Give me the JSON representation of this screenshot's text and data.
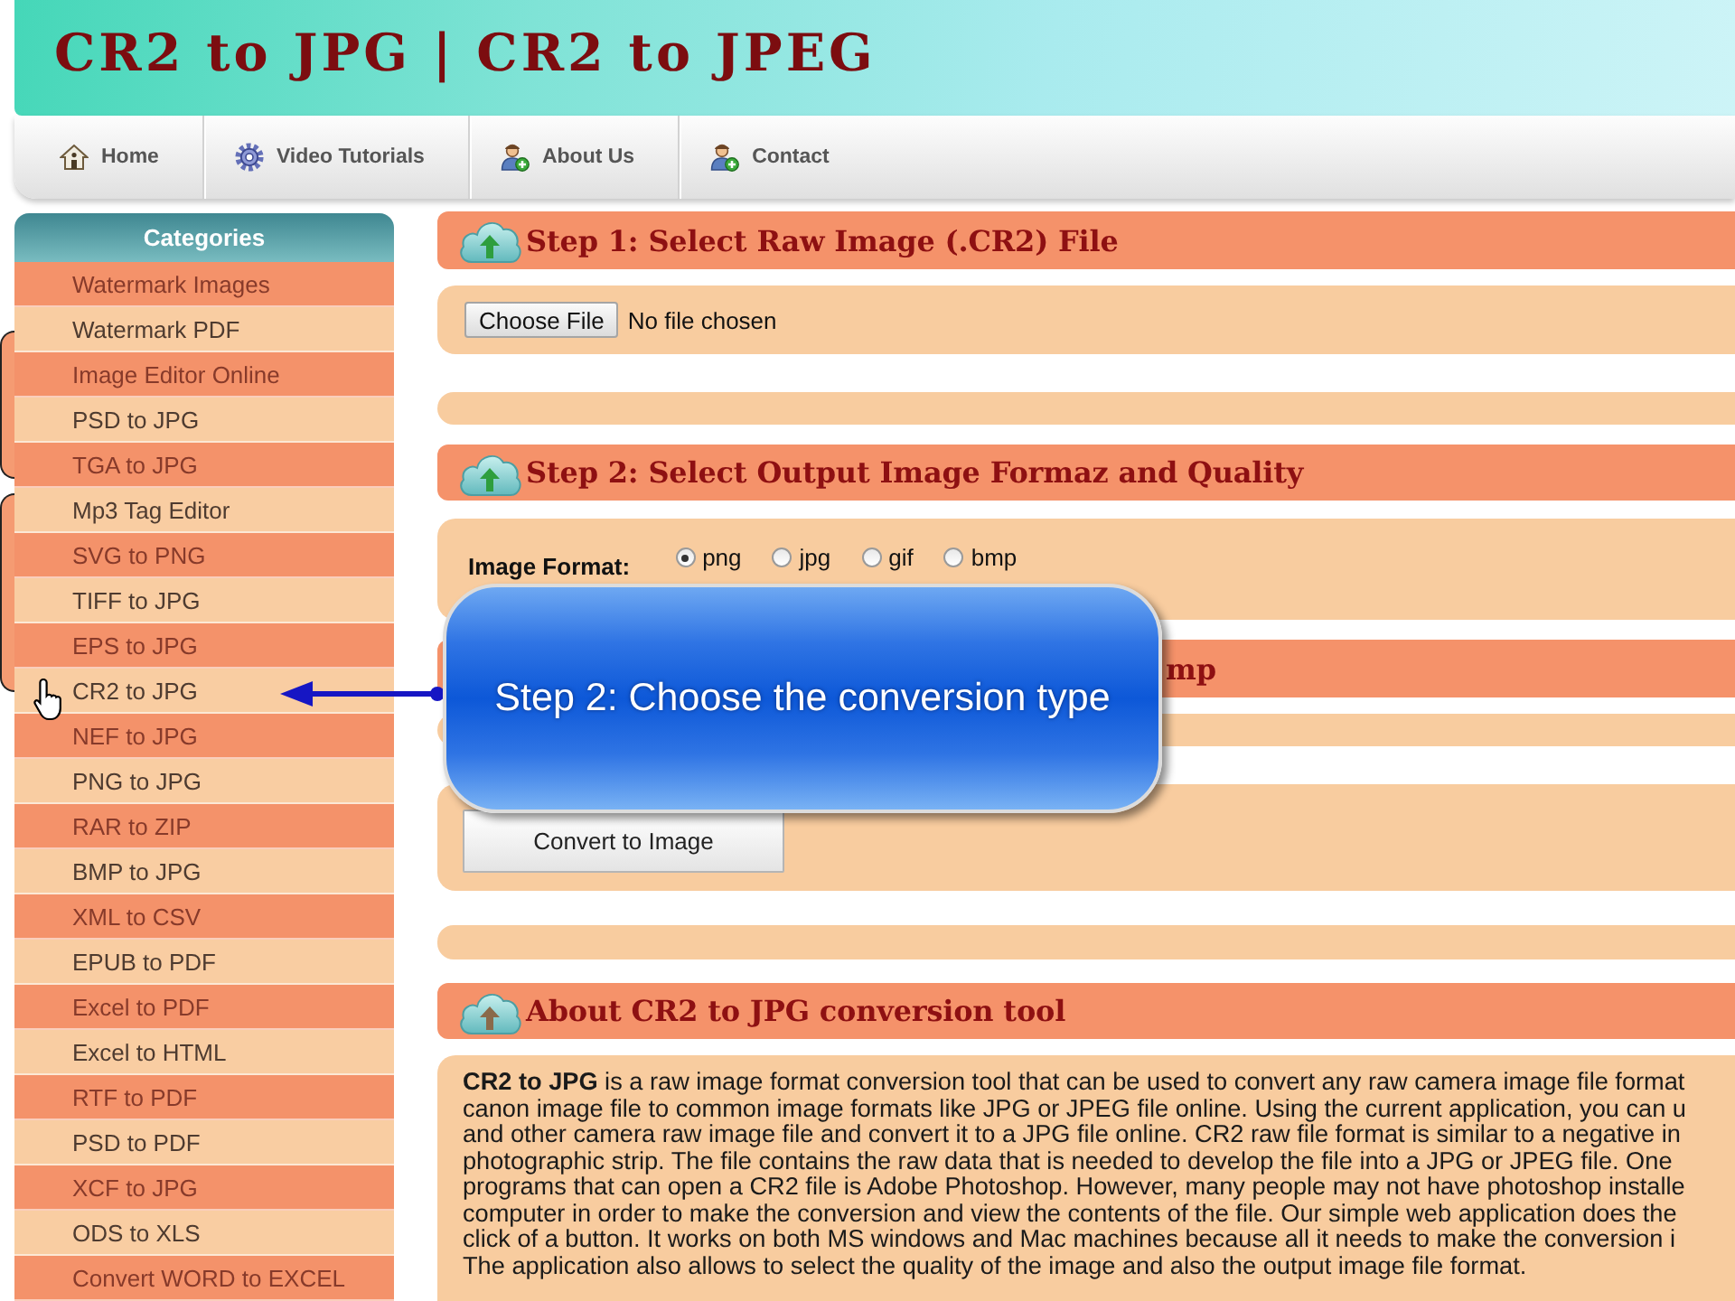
{
  "header": {
    "title": "CR2 to JPG | CR2 to JPEG"
  },
  "nav": [
    "Home",
    "Video Tutorials",
    "About Us",
    "Contact"
  ],
  "sidebar": {
    "title": "Categories",
    "items": [
      "Watermark Images",
      "Watermark PDF",
      "Image Editor Online",
      "PSD to JPG",
      "TGA to JPG",
      "Mp3 Tag Editor",
      "SVG to PNG",
      "TIFF to JPG",
      "EPS to JPG",
      "CR2 to JPG",
      "NEF to JPG",
      "PNG to JPG",
      "RAR to ZIP",
      "BMP to JPG",
      "XML to CSV",
      "EPUB to PDF",
      "Excel to PDF",
      "Excel to HTML",
      "RTF to PDF",
      "PSD to PDF",
      "XCF to JPG",
      "ODS to XLS",
      "Convert WORD to EXCEL"
    ]
  },
  "step1": {
    "title": "Step 1: Select Raw Image (.CR2) File",
    "file_button": "Choose File",
    "file_status": "No file chosen"
  },
  "step2": {
    "title": "Step 2: Select Output Image Formaz and Quality",
    "format_label": "Image Format:",
    "formats": [
      {
        "label": "png",
        "selected": true
      },
      {
        "label": "jpg",
        "selected": false
      },
      {
        "label": "gif",
        "selected": false
      },
      {
        "label": "bmp",
        "selected": false
      }
    ]
  },
  "step3": {
    "title": "mp",
    "button": "Convert to Image"
  },
  "about": {
    "title": "About CR2 to JPG conversion tool",
    "lines": [
      "**CR2 to JPG** is a raw image format conversion tool that can be used to convert any raw camera image file format",
      "canon image file to common image formats like JPG or JPEG file online. Using the current application, you can u",
      "and other camera raw image file and convert it to a JPG file online. CR2 raw file format is similar to a negative in",
      "photographic strip. The file contains the raw data that is needed to develop the file into a JPG or JPEG file. One",
      "programs that can open a CR2 file is Adobe Photoshop. However, many people may not have photoshop installe",
      "computer in order to make the conversion and view the contents of the file. Our simple web application does the",
      "click of a button. It works on both MS windows and Mac machines because all it needs to make the conversion i",
      "The application also allows to select the quality of the image and also the output image file format."
    ]
  },
  "callout": {
    "text": "Step 2: Choose the conversion type"
  }
}
